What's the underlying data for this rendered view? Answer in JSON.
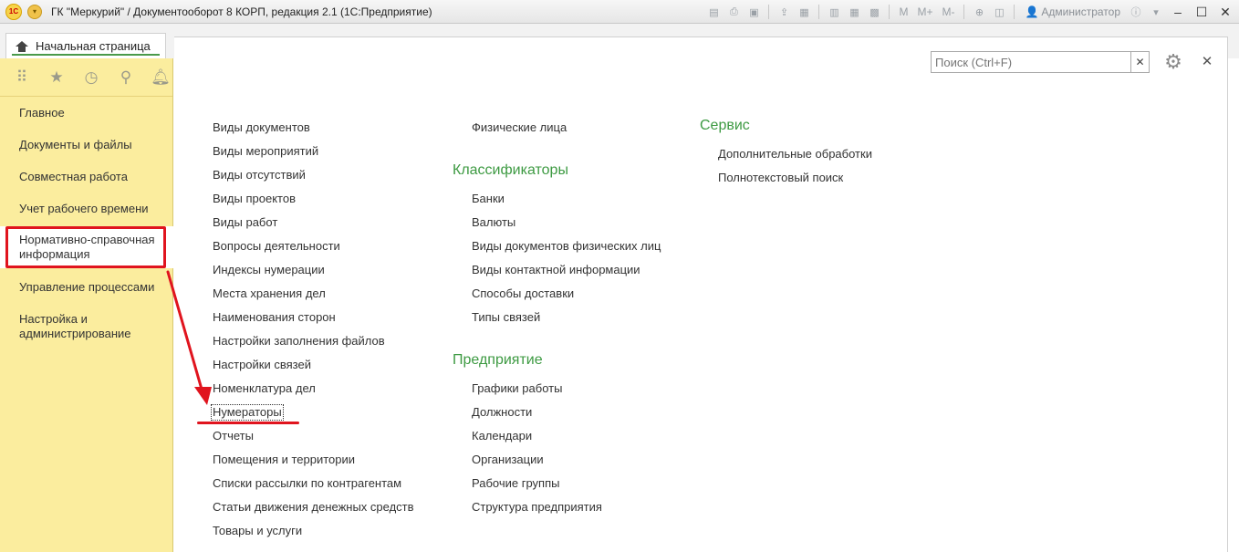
{
  "window": {
    "title": "ГК \"Меркурий\" / Документооборот 8 КОРП, редакция 2.1  (1С:Предприятие)",
    "user": "Администратор",
    "toolbar_text": [
      "M",
      "M+",
      "M-"
    ]
  },
  "tabs": {
    "home": "Начальная страница"
  },
  "panel_icons": [
    "apps-icon",
    "star-icon",
    "history-icon",
    "search-icon",
    "bell-icon"
  ],
  "sections": [
    "Главное",
    "Документы и файлы",
    "Совместная работа",
    "Учет рабочего времени",
    "Нормативно-справочная информация",
    "Управление процессами",
    "Настройка и администрирование"
  ],
  "active_section": "Нормативно-справочная информация",
  "search": {
    "placeholder": "Поиск (Ctrl+F)"
  },
  "column1": [
    "Виды документов",
    "Виды мероприятий",
    "Виды отсутствий",
    "Виды проектов",
    "Виды работ",
    "Вопросы деятельности",
    "Индексы нумерации",
    "Места хранения дел",
    "Наименования сторон",
    "Настройки заполнения файлов",
    "Настройки связей",
    "Номенклатура дел",
    "Нумераторы",
    "Отчеты",
    "Помещения и территории",
    "Списки рассылки по контрагентам",
    "Статьи движения денежных средств",
    "Товары и услуги"
  ],
  "column2": {
    "top_item": "Физические лица",
    "groups": [
      {
        "title": "Классификаторы",
        "items": [
          "Банки",
          "Валюты",
          "Виды документов физических лиц",
          "Виды контактной информации",
          "Способы доставки",
          "Типы связей"
        ]
      },
      {
        "title": "Предприятие",
        "items": [
          "Графики работы",
          "Должности",
          "Календари",
          "Организации",
          "Рабочие группы",
          "Структура предприятия"
        ]
      }
    ]
  },
  "column3": {
    "groups": [
      {
        "title": "Сервис",
        "items": [
          "Дополнительные обработки",
          "Полнотекстовый поиск"
        ]
      }
    ]
  },
  "highlighted_item": "Нумераторы",
  "annotation_color": "#e0141e"
}
